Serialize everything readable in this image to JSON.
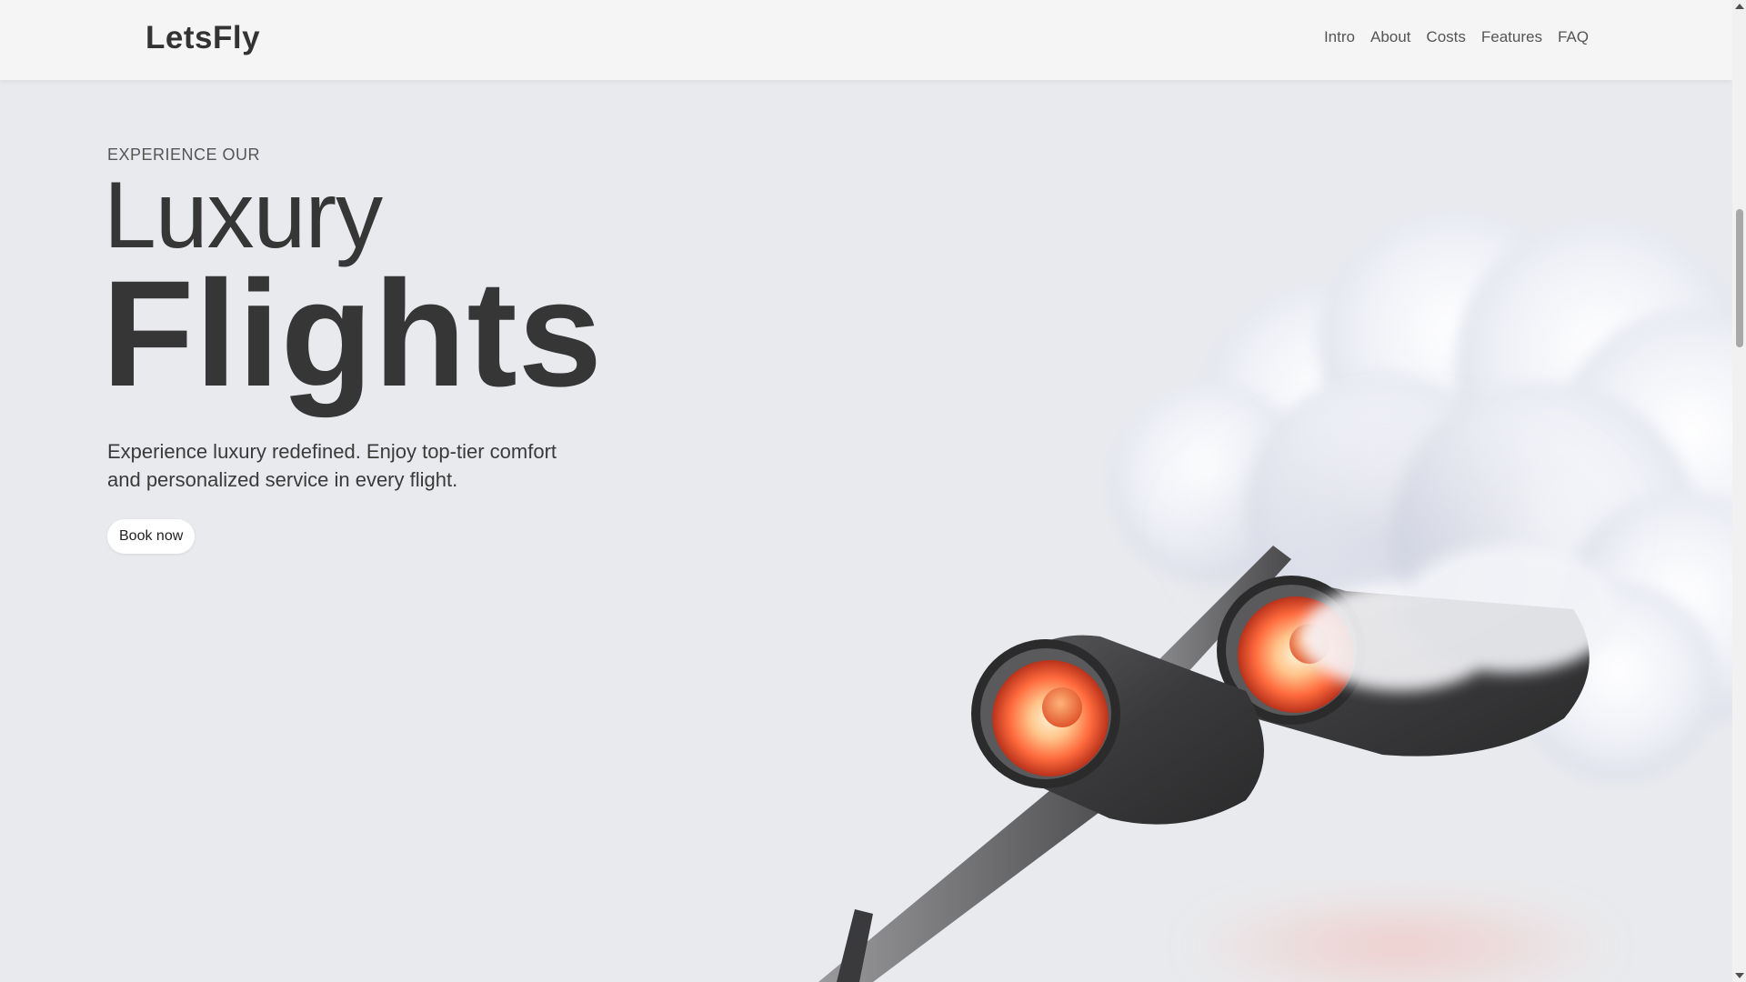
{
  "header": {
    "logo": "LetsFly",
    "nav": [
      {
        "label": "Intro"
      },
      {
        "label": "About"
      },
      {
        "label": "Costs"
      },
      {
        "label": "Features"
      },
      {
        "label": "FAQ"
      }
    ]
  },
  "hero": {
    "eyebrow": "EXPERIENCE OUR",
    "title_light": "Luxury",
    "title_bold": "Flights",
    "description": "Experience luxury redefined. Enjoy top-tier comfort and personalized service in every flight.",
    "cta_label": "Book now"
  },
  "illustration": {
    "icon": "jet-engines-in-cloud-illustration"
  },
  "colors": {
    "background": "#e9eaed",
    "header_bg": "#f5f5f5",
    "text": "#363636",
    "engine_glow": "#ff6a3d",
    "cloud": "#ffffff"
  }
}
